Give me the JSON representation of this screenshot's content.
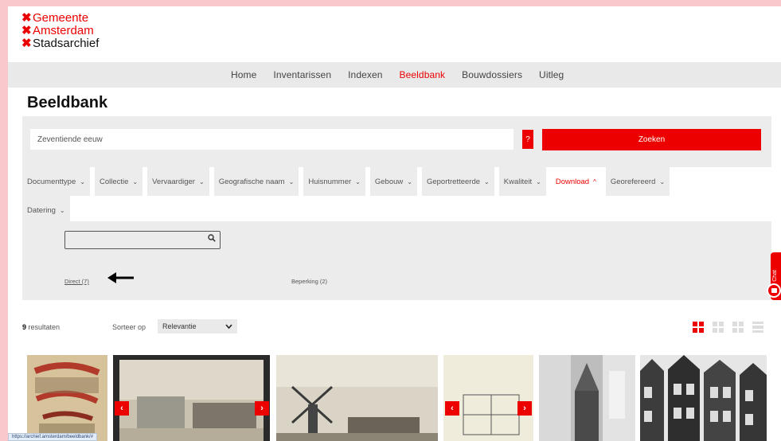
{
  "logo": {
    "line1": "Gemeente",
    "line2": "Amsterdam",
    "line3": "Stadsarchief",
    "x_mark": "✖"
  },
  "topnav": {
    "items": [
      "Home",
      "Inventarissen",
      "Indexen",
      "Beeldbank",
      "Bouwdossiers",
      "Uitleg"
    ],
    "active": "Beeldbank"
  },
  "page": {
    "title": "Beeldbank"
  },
  "search": {
    "value": "Zeventiende eeuw",
    "help_label": "?",
    "button_label": "Zoeken"
  },
  "filters": {
    "row1": [
      "Documenttype",
      "Collectie",
      "Vervaardiger",
      "Geografische naam",
      "Huisnummer",
      "Gebouw",
      "Geportretteerde",
      "Kwaliteit",
      "Download",
      "Georefereerd"
    ],
    "row2": [
      "Datering"
    ],
    "active": "Download",
    "chevron_down": "⌄",
    "chevron_up": "^"
  },
  "download_panel": {
    "search_placeholder": "",
    "search_icon": "🔍",
    "option_direct": "Direct (7)",
    "option_beperking": "Beperking (2)",
    "arrow": "🡐"
  },
  "results": {
    "count": "9",
    "count_suffix": "resultaten",
    "sort_label": "Sorteer op",
    "sort_value": "Relevantie",
    "sort_chevron": "⌄"
  },
  "view_modes": [
    "grid-large-icon",
    "grid-list-icon",
    "grid-small-icon",
    "list-icon"
  ],
  "chat": {
    "label": "Chat"
  },
  "status_bar": {
    "url": "https://archief.amsterdam/beeldbank/#"
  },
  "colors": {
    "accent": "#ec0000",
    "panel": "#ececec",
    "frame": "#f9c8cc"
  }
}
